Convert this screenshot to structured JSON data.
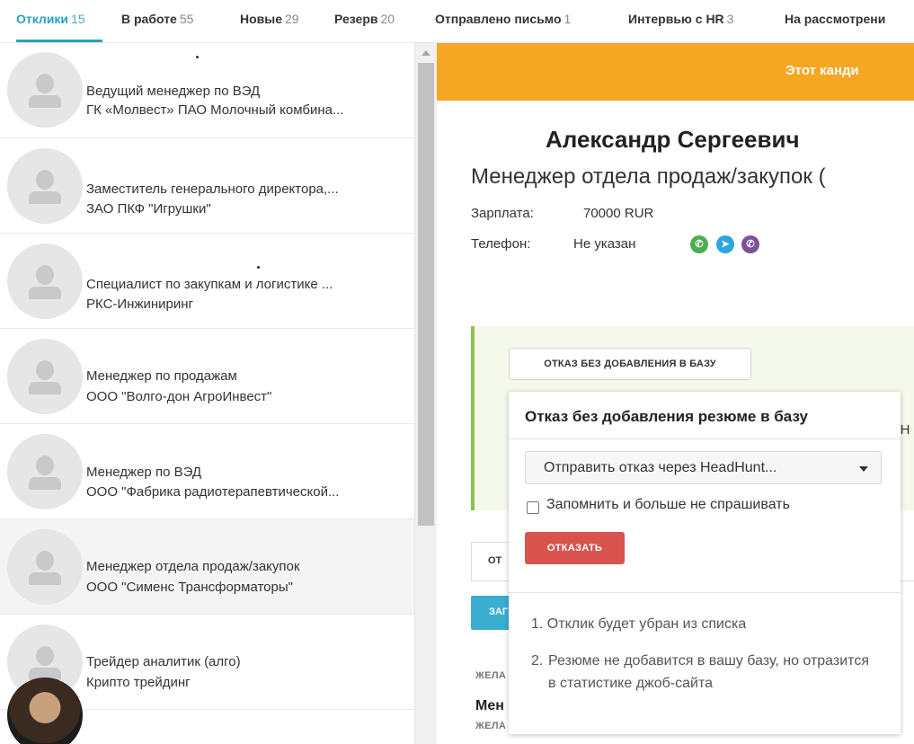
{
  "tabs": [
    {
      "label": "Отклики",
      "count": "15"
    },
    {
      "label": "В работе",
      "count": "55"
    },
    {
      "label": "Новые",
      "count": "29"
    },
    {
      "label": "Резерв",
      "count": "20"
    },
    {
      "label": "Отправлено письмо",
      "count": "1"
    },
    {
      "label": "Интервью с HR",
      "count": "3"
    },
    {
      "label": "На рассмотрени",
      "count": ""
    }
  ],
  "candidates": [
    {
      "title": "Ведущий менеджер по ВЭД",
      "company": "ГК «Молвест» ПАО Молочный комбина..."
    },
    {
      "title": "Заместитель генерального директора,...",
      "company": "ЗАО ПКФ \"Игрушки\""
    },
    {
      "title": "Специалист по закупкам и логистике ...",
      "company": "РКС-Инжиниринг"
    },
    {
      "title": "Менеджер по продажам",
      "company": "ООО \"Волго-дон АгроИнвест\""
    },
    {
      "title": "Менеджер по ВЭД",
      "company": "ООО \"Фабрика радиотерапевтической..."
    },
    {
      "title": "Менеджер отдела продаж/закупок",
      "company": "ООО \"Сименс Трансформаторы\""
    },
    {
      "title": "Трейдер аналитик (алго)",
      "company": "Крипто трейдинг"
    }
  ],
  "banner": {
    "text": "Этот канди"
  },
  "candidate": {
    "name": "Александр Сергеевич",
    "position": "Менеджер отдела продаж/закупок (",
    "salary_label": "Зарплата:",
    "salary_value": "70000 RUR",
    "phone_label": "Телефон:",
    "phone_value": "Не указан"
  },
  "messengers": [
    {
      "name": "whatsapp",
      "color": "#4cae4c"
    },
    {
      "name": "telegram",
      "color": "#2ca5e0"
    },
    {
      "name": "viber",
      "color": "#7b519d"
    }
  ],
  "actions": {
    "reject_no_db_label": "ОТКАЗ БЕЗ ДОБАВЛЕНИЯ В БАЗУ",
    "right_fragment": "ОН"
  },
  "popup": {
    "title": "Отказ без добавления резюме в базу",
    "select_value": "Отправить отказ через HeadHunt...",
    "remember_label": "Запомнить и больше не спрашивать",
    "reject_button": "ОТКАЗАТЬ",
    "note1_num": "1.",
    "note1_text": "Отклик будет убран из списка",
    "note2_num": "2.",
    "note2_text": "Резюме не добавится в вашу базу, но отразится в статистике джоб-сайта"
  },
  "lower": {
    "tab_fragment": "ОТ",
    "teal_fragment": "ЗАГ",
    "section_label1": "ЖЕЛА",
    "section_title": "Мен",
    "section_label2": "ЖЕЛА"
  },
  "colors": {
    "accent": "#2aa1c0",
    "banner": "#f5a623",
    "reject": "#d9534f",
    "success_border": "#8bc34a"
  }
}
